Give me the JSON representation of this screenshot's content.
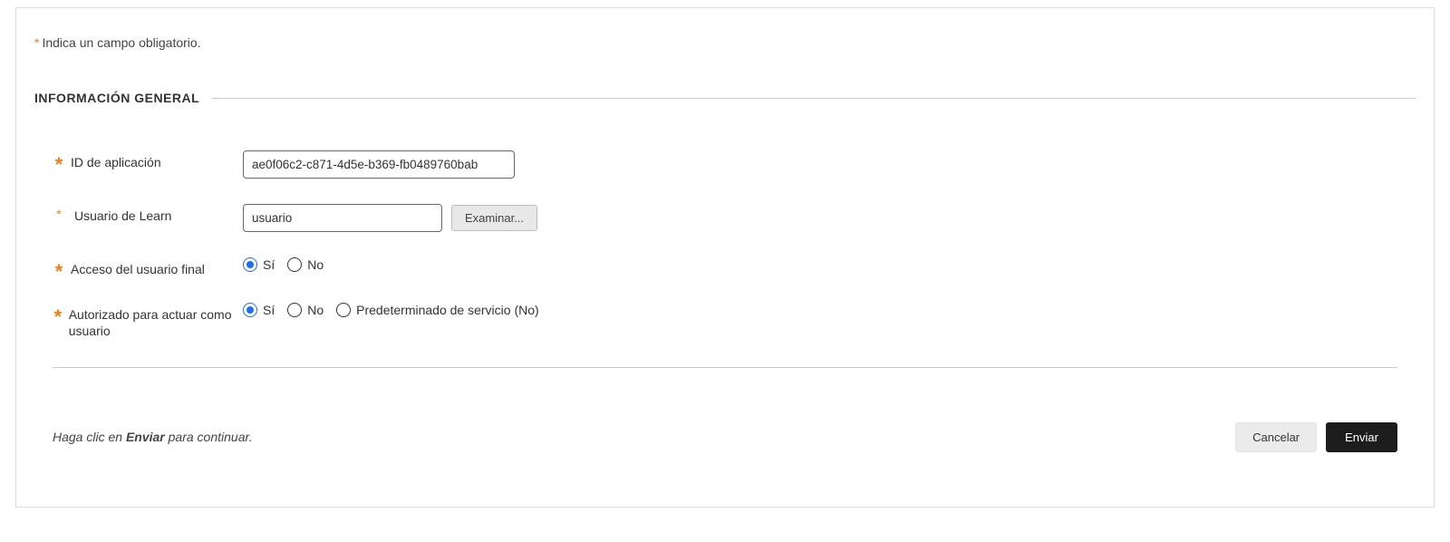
{
  "required_note": {
    "star": "*",
    "text": "Indica un campo obligatorio."
  },
  "section_title": "INFORMACIÓN GENERAL",
  "fields": {
    "app_id": {
      "label": "ID de aplicación",
      "value": "ae0f06c2-c871-4d5e-b369-fb0489760bab"
    },
    "learn_user": {
      "label": "Usuario de Learn",
      "value": "usuario",
      "browse": "Examinar..."
    },
    "end_user_access": {
      "label": "Acceso del usuario final",
      "options": {
        "yes": "Sí",
        "no": "No"
      },
      "selected": "yes"
    },
    "act_as_user": {
      "label": "Autorizado para actuar como usuario",
      "options": {
        "yes": "Sí",
        "no": "No",
        "default": "Predeterminado de servicio (No)"
      },
      "selected": "yes"
    }
  },
  "footer": {
    "hint_prefix": "Haga clic en ",
    "hint_strong": "Enviar",
    "hint_suffix": " para continuar.",
    "cancel": "Cancelar",
    "submit": "Enviar"
  }
}
